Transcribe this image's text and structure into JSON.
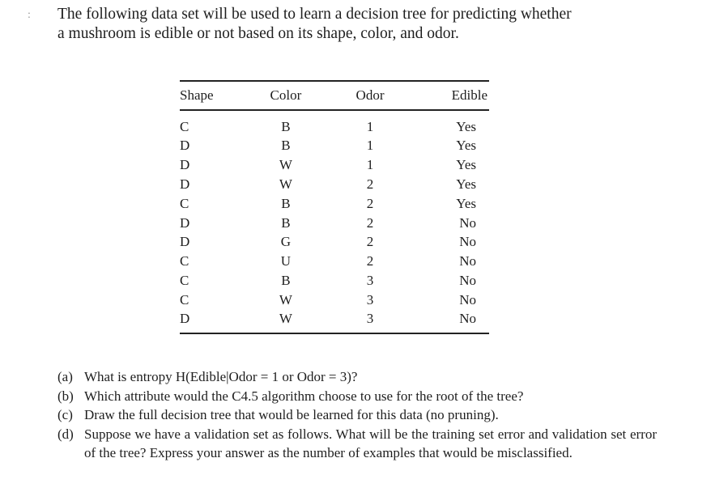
{
  "intro": {
    "line1": "The following data set will be used to learn a decision tree for predicting whether",
    "line2": "a mushroom is edible or not based on its shape, color, and odor."
  },
  "table": {
    "headers": [
      "Shape",
      "Color",
      "Odor",
      "Edible"
    ],
    "rows": [
      [
        "C",
        "B",
        "1",
        "Yes"
      ],
      [
        "D",
        "B",
        "1",
        "Yes"
      ],
      [
        "D",
        "W",
        "1",
        "Yes"
      ],
      [
        "D",
        "W",
        "2",
        "Yes"
      ],
      [
        "C",
        "B",
        "2",
        "Yes"
      ],
      [
        "D",
        "B",
        "2",
        "No"
      ],
      [
        "D",
        "G",
        "2",
        "No"
      ],
      [
        "C",
        "U",
        "2",
        "No"
      ],
      [
        "C",
        "B",
        "3",
        "No"
      ],
      [
        "C",
        "W",
        "3",
        "No"
      ],
      [
        "D",
        "W",
        "3",
        "No"
      ]
    ]
  },
  "questions": [
    {
      "label": "(a)",
      "text": "What is entropy H(Edible|Odor = 1 or Odor = 3)?"
    },
    {
      "label": "(b)",
      "text": "Which attribute would the C4.5 algorithm choose to use for the root of the tree?"
    },
    {
      "label": "(c)",
      "text": "Draw the full decision tree that would be learned for this data (no pruning)."
    },
    {
      "label": "(d)",
      "text": "Suppose we have a validation set as follows. What will be the training set error and validation set error of the tree? Express your answer as the number of examples that would be misclassified."
    }
  ]
}
